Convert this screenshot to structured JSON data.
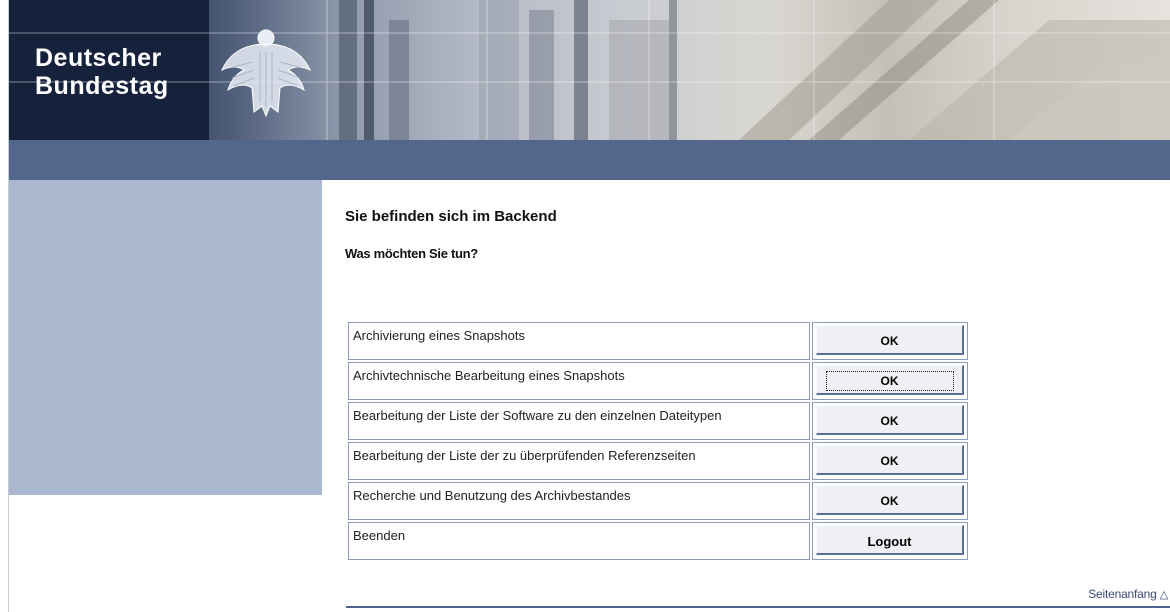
{
  "header": {
    "brand_line1": "Deutscher",
    "brand_line2": "Bundestag"
  },
  "main": {
    "title": "Sie befinden sich im Backend",
    "subtitle": "Was möchten Sie tun?"
  },
  "actions": [
    {
      "label": "Archivierung eines Snapshots",
      "button": "OK"
    },
    {
      "label": "Archivtechnische Bearbeitung eines Snapshots",
      "button": "OK"
    },
    {
      "label": "Bearbeitung der Liste der Software zu den einzelnen Dateitypen",
      "button": "OK"
    },
    {
      "label": "Bearbeitung der Liste der zu überprüfenden Referenzseiten",
      "button": "OK"
    },
    {
      "label": "Recherche und Benutzung des Archivbestandes",
      "button": "OK"
    },
    {
      "label": "Beenden",
      "button": "Logout"
    }
  ],
  "footer": {
    "top_link": "Seitenanfang",
    "top_link_icon": "arrow-up-icon"
  },
  "colors": {
    "nav_bar": "#53668c",
    "sidebar": "#abb6cf",
    "table_border": "#8c9bba"
  }
}
